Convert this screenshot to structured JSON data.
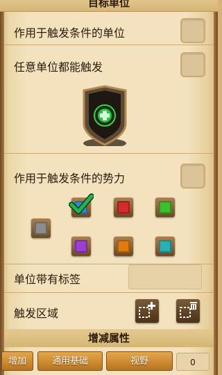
{
  "header": {
    "title": "目标单位"
  },
  "rows": {
    "trigger_unit_label": "作用于触发条件的单位",
    "any_unit_label": "任意单位都能触发",
    "trigger_force_label": "作用于触发条件的势力",
    "unit_tag_label": "单位带有标签",
    "trigger_area_label": "触发区域"
  },
  "checkboxes": {
    "trigger_unit": false,
    "any_unit": false,
    "trigger_force": false
  },
  "forces": [
    {
      "color": "#8c8c8c",
      "checked": false
    },
    {
      "color": "#2e8fd0",
      "checked": true
    },
    {
      "color": "#d42a2a",
      "checked": false
    },
    {
      "color": "#3fbf2c",
      "checked": false
    },
    {
      "color": "#9b3fd0",
      "checked": false
    },
    {
      "color": "#e07c0f",
      "checked": false
    },
    {
      "color": "#2bb0b0",
      "checked": false
    }
  ],
  "attributes": {
    "title": "增减属性"
  },
  "buttons": {
    "add_label": "增加",
    "general_label": "通用基础",
    "vision_label": "视野"
  },
  "value": {
    "amount": "0"
  },
  "icons": {
    "shield": "shield-plus-icon",
    "add_area": "add-area-icon",
    "delete_area": "delete-area-icon"
  },
  "colors": {
    "accent": "#d99a3f",
    "panel": "#f3e2bd",
    "check": "#1fa14a"
  }
}
